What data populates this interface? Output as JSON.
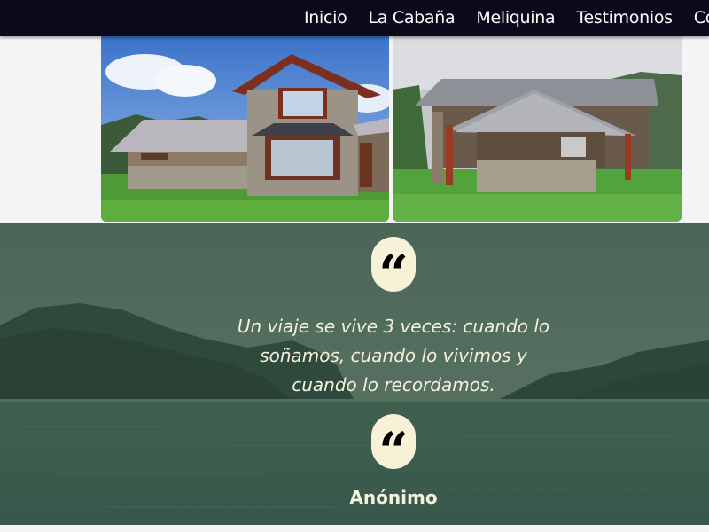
{
  "nav": {
    "items": [
      "Inicio",
      "La Cabaña",
      "Meliquina",
      "Testimonios",
      "Co"
    ]
  },
  "gallery": {
    "photos": [
      {
        "subject": "stone-cabin-front"
      },
      {
        "subject": "stone-cabin-side"
      }
    ]
  },
  "testimonial": {
    "quote_icon": "quote-icon",
    "text": "Un viaje se vive 3 veces: cuando lo soñamos, cuando lo vivimos y cuando lo recordamos.",
    "author": "Anónimo"
  },
  "colors": {
    "navbar": "#0b0a1a",
    "overlay": "#3b5a4b",
    "quote_bubble": "#f6f1d7",
    "text_light": "#f3f0dc"
  }
}
